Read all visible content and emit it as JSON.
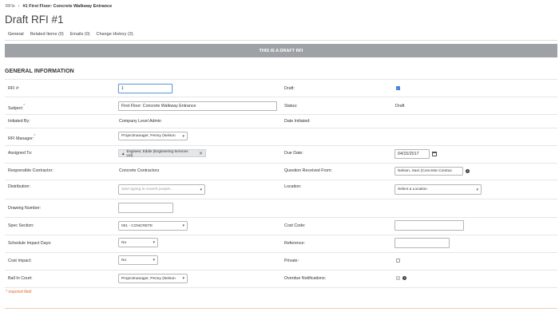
{
  "breadcrumb": {
    "root": "RFIs",
    "current": "#1 First Floor: Concrete Walkway Entrance"
  },
  "page": {
    "title": "Draft RFI #1"
  },
  "tabs": [
    {
      "label": "General"
    },
    {
      "label": "Related Items (0)"
    },
    {
      "label": "Emails (0)"
    },
    {
      "label": "Change History (3)"
    }
  ],
  "banner": "THIS IS A DRAFT RFI",
  "section_title": "GENERAL INFORMATION",
  "fields": {
    "rfi_number": {
      "label": "RFI #:",
      "value": "1"
    },
    "draft": {
      "label": "Draft:",
      "checked": true
    },
    "subject": {
      "label": "Subject:",
      "value": "First Floor: Concrete Walkway Entrance"
    },
    "status": {
      "label": "Status:",
      "value": "Draft"
    },
    "initiated_by": {
      "label": "Initiated By:",
      "value": "Company Level Admin"
    },
    "date_initiated": {
      "label": "Date Initiated:",
      "value": ""
    },
    "rfi_manager": {
      "label": "RFI Manager:",
      "value": "Projectmanager, Penny (Nelson"
    },
    "assigned_to": {
      "label": "Assigned To:",
      "value": "Engineer, Eddie (Engineering Services Ltd)"
    },
    "due_date": {
      "label": "Due Date:",
      "value": "04/15/2017"
    },
    "responsible_contractor": {
      "label": "Responsible Contractor:",
      "value": "Concrete Contractors"
    },
    "question_received_from": {
      "label": "Question Received From:",
      "value": "Nelson, Sam (Concrete Contrac"
    },
    "distribution": {
      "label": "Distribution:",
      "placeholder": "Start typing to search people..."
    },
    "location": {
      "label": "Location:",
      "value": "Select a Location"
    },
    "drawing_number": {
      "label": "Drawing Number:",
      "value": ""
    },
    "spec_section": {
      "label": "Spec Section:",
      "value": "001 - CONCRETE"
    },
    "cost_code": {
      "label": "Cost Code:",
      "value": ""
    },
    "schedule_impact_days": {
      "label": "Schedule Impact Days:",
      "value": "No"
    },
    "reference": {
      "label": "Reference:",
      "value": ""
    },
    "cost_impact": {
      "label": "Cost Impact:",
      "value": "No"
    },
    "private": {
      "label": "Private:",
      "checked": false
    },
    "ball_in_court": {
      "label": "Ball In Court:",
      "value": "Projectmanager, Penny (Nelson"
    },
    "overdue_notifications": {
      "label": "Overdue Notifications:",
      "checked": true
    }
  },
  "footnote": "* required field",
  "colors": {
    "accent": "#e06a2c",
    "banner_bg": "#9ea2a6",
    "focus": "#6aa3d5"
  },
  "icons": {
    "breadcrumb_sep": "chevron-right-icon",
    "user": "user-icon",
    "remove": "close-icon",
    "calendar": "calendar-icon",
    "help": "help-icon",
    "dropdown": "chevron-down-icon"
  }
}
